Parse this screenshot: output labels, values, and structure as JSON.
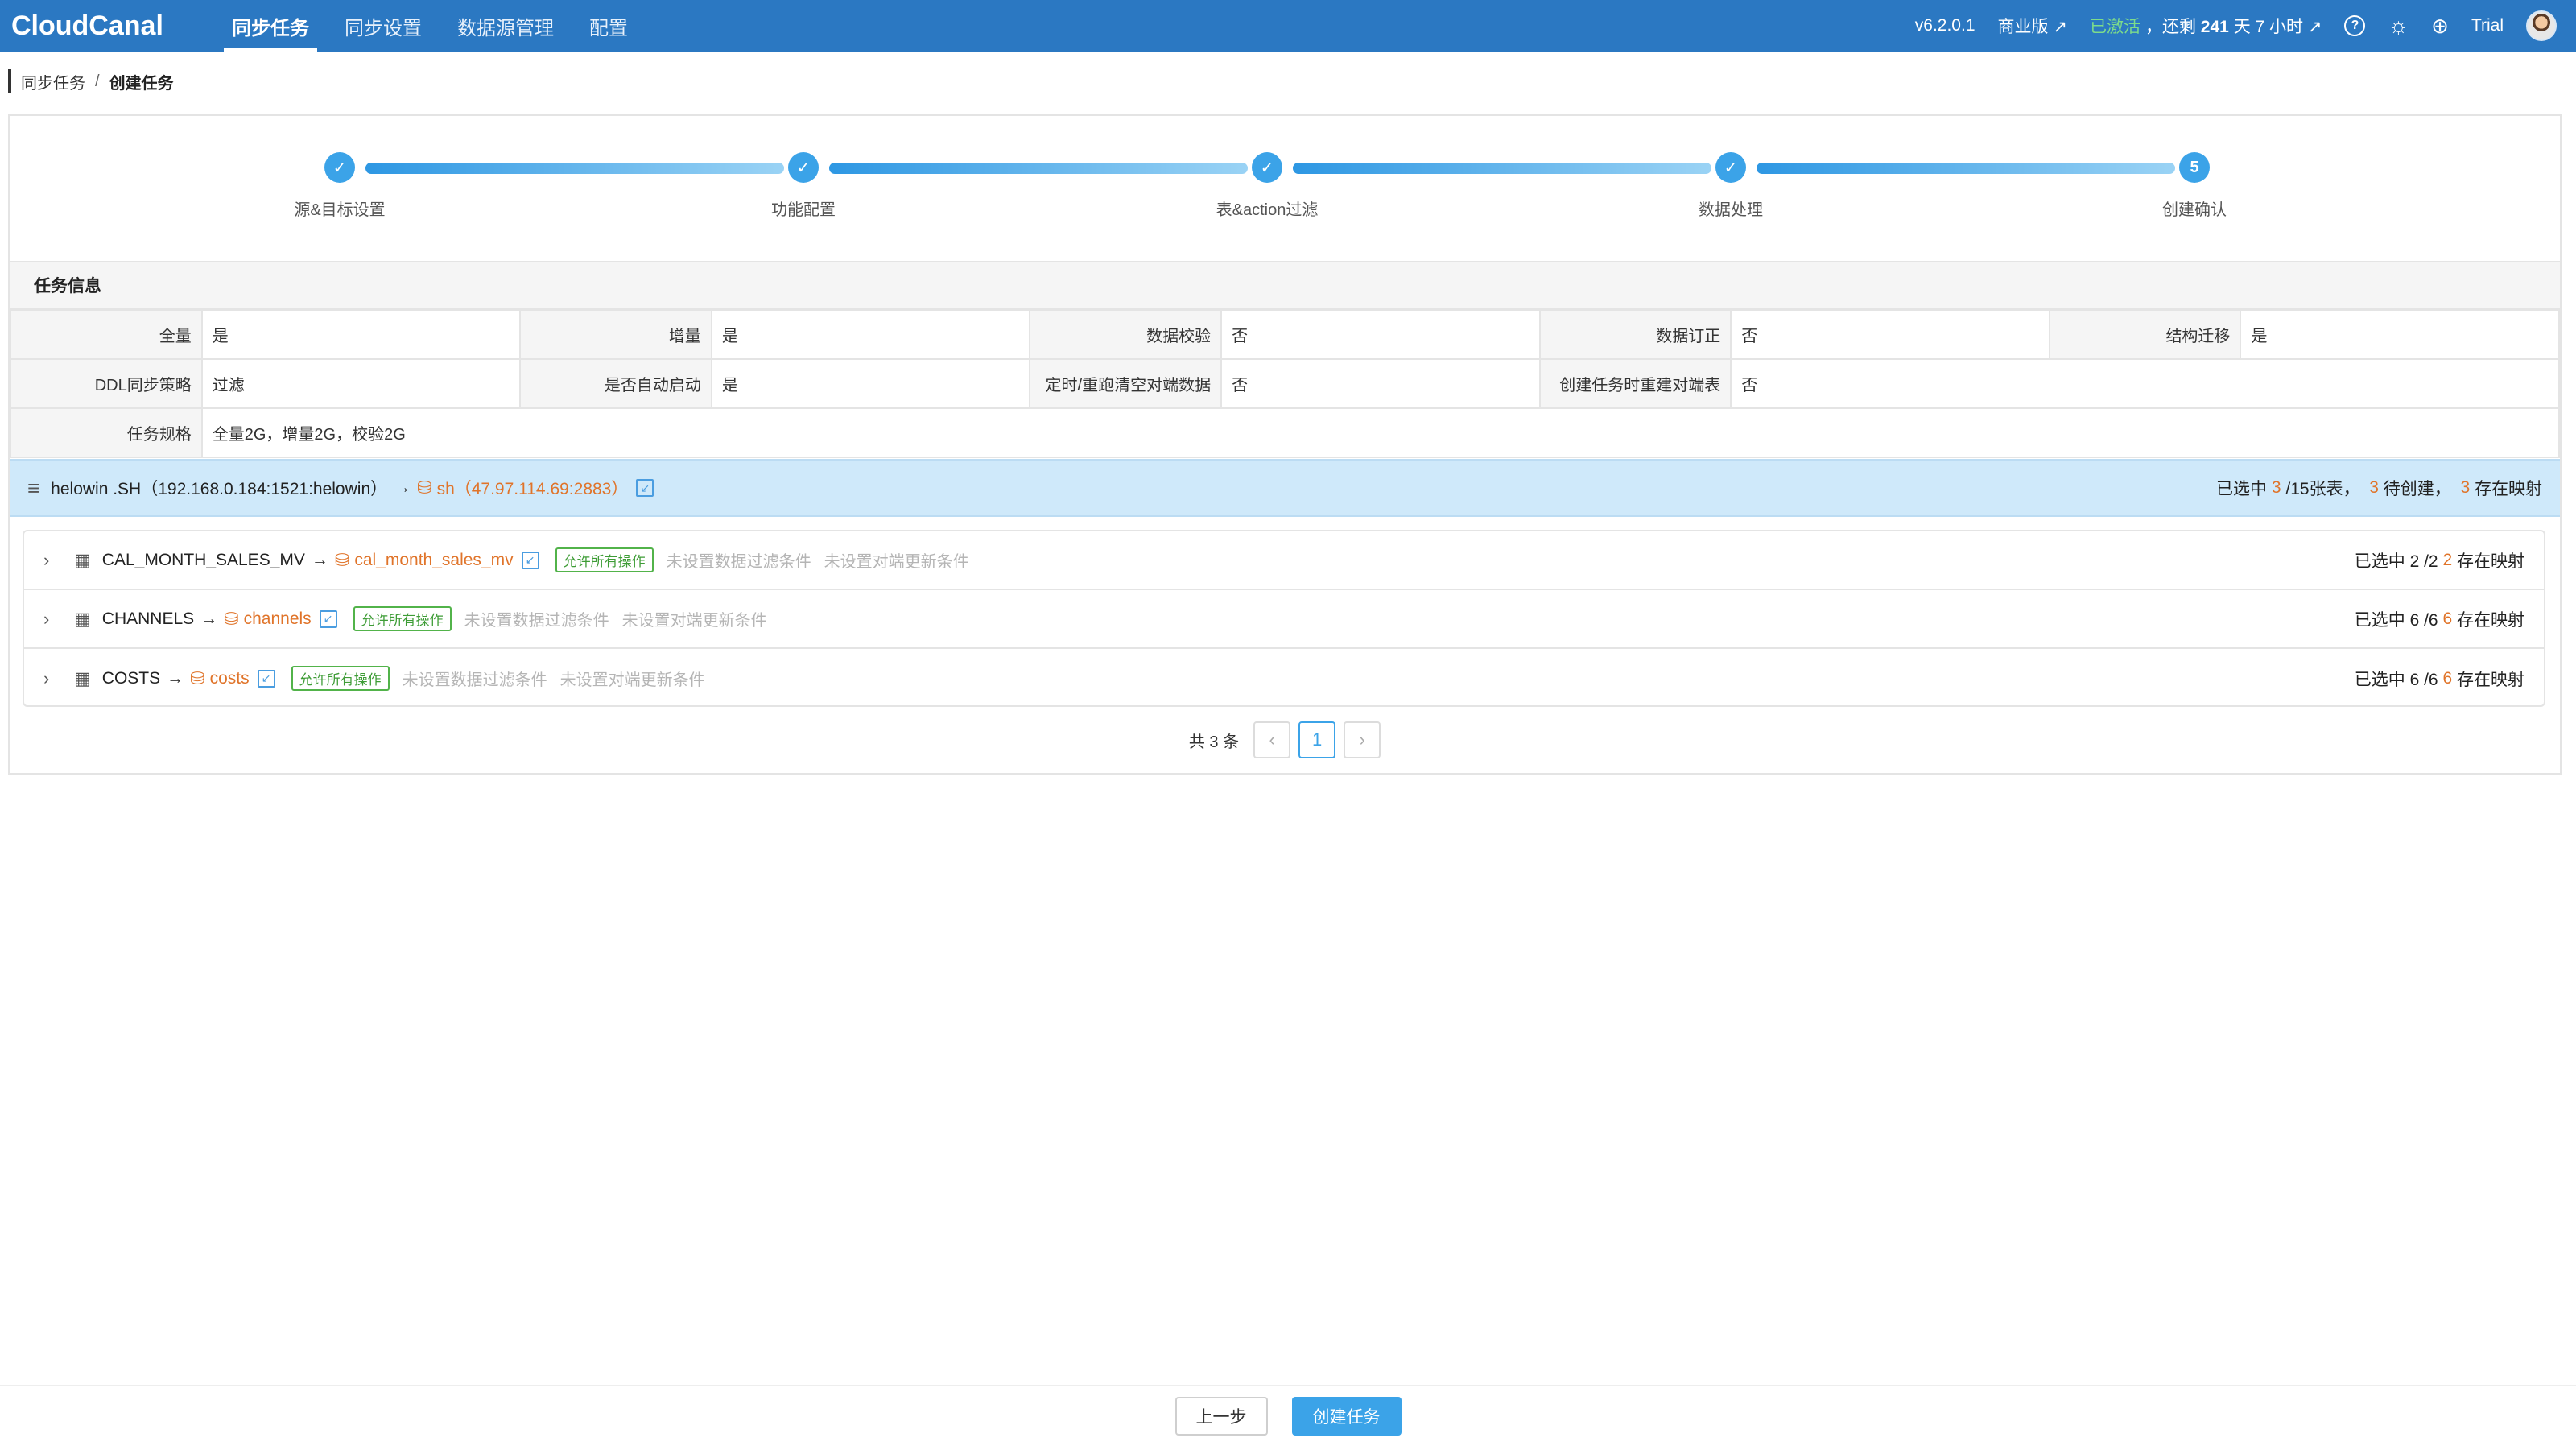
{
  "header": {
    "logo": "CloudCanal",
    "nav": [
      "同步任务",
      "同步设置",
      "数据源管理",
      "配置"
    ],
    "version": "v6.2.0.1",
    "edition": "商业版 ↗",
    "activated": "已激活",
    "remaining_prefix": "，还剩",
    "remaining_days": "241",
    "remaining_suffix": "天 7 小时 ↗",
    "help": "?",
    "user": "Trial"
  },
  "breadcrumb": {
    "parent": "同步任务",
    "separator": "/",
    "current": "创建任务"
  },
  "steps": [
    {
      "label": "源&目标设置",
      "mark": "✓"
    },
    {
      "label": "功能配置",
      "mark": "✓"
    },
    {
      "label": "表&action过滤",
      "mark": "✓"
    },
    {
      "label": "数据处理",
      "mark": "✓"
    },
    {
      "label": "创建确认",
      "mark": "5"
    }
  ],
  "task_info": {
    "title": "任务信息",
    "row1": [
      {
        "label": "全量",
        "value": "是"
      },
      {
        "label": "增量",
        "value": "是"
      },
      {
        "label": "数据校验",
        "value": "否"
      },
      {
        "label": "数据订正",
        "value": "否"
      },
      {
        "label": "结构迁移",
        "value": "是"
      }
    ],
    "row2": [
      {
        "label": "DDL同步策略",
        "value": "过滤"
      },
      {
        "label": "是否自动启动",
        "value": "是"
      },
      {
        "label": "定时/重跑清空对端数据",
        "value": "否"
      },
      {
        "label": "创建任务时重建对端表",
        "value": "否"
      }
    ],
    "row3": {
      "label": "任务规格",
      "value": "全量2G，增量2G，校验2G"
    }
  },
  "mapping": {
    "source": "helowin .SH（192.168.0.184:1521:helowin）",
    "arrow": "→",
    "target": "sh（47.97.114.69:2883）",
    "summary": {
      "selected_prefix": "已选中",
      "selected": "3",
      "total": "/15张表，",
      "pending": "3",
      "pending_label": "待创建，",
      "mapped": "3",
      "mapped_label": "存在映射"
    }
  },
  "tables": [
    {
      "source": "CAL_MONTH_SALES_MV",
      "target": "cal_month_sales_mv",
      "tag": "允许所有操作",
      "filter": "未设置数据过滤条件",
      "update": "未设置对端更新条件",
      "selected": "已选中 2 /2",
      "mapped": "2",
      "mapped_label": "存在映射"
    },
    {
      "source": "CHANNELS",
      "target": "channels",
      "tag": "允许所有操作",
      "filter": "未设置数据过滤条件",
      "update": "未设置对端更新条件",
      "selected": "已选中 6 /6",
      "mapped": "6",
      "mapped_label": "存在映射"
    },
    {
      "source": "COSTS",
      "target": "costs",
      "tag": "允许所有操作",
      "filter": "未设置数据过滤条件",
      "update": "未设置对端更新条件",
      "selected": "已选中 6 /6",
      "mapped": "6",
      "mapped_label": "存在映射"
    }
  ],
  "pagination": {
    "total": "共 3 条",
    "current": "1",
    "prev": "‹",
    "next": "›"
  },
  "footer": {
    "prev_label": "上一步",
    "create_label": "创建任务"
  }
}
